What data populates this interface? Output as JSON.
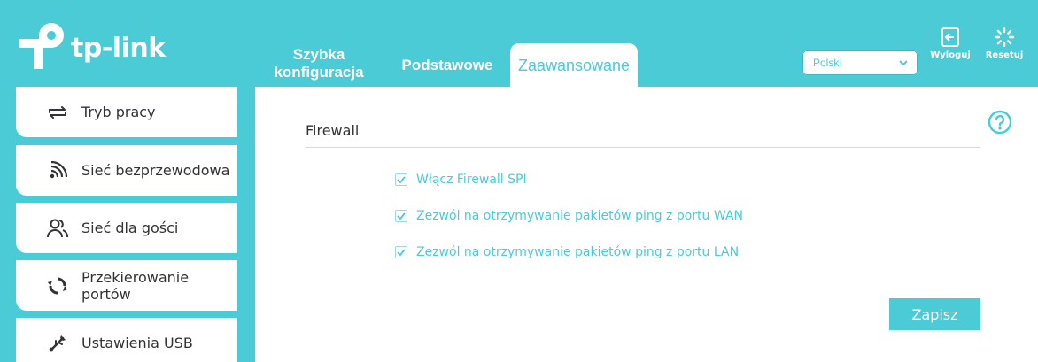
{
  "header": {
    "logo_text": "tp-link",
    "tabs": [
      {
        "line1": "Szybka",
        "line2": "konfiguracja"
      },
      {
        "label": "Podstawowe"
      },
      {
        "label": "Zaawansowane"
      }
    ],
    "language": "Polski",
    "logout_label": "Wyloguj",
    "reset_label": "Resetuj"
  },
  "sidebar": {
    "items": [
      {
        "label": "Tryb pracy",
        "icon": "mode-switch-icon"
      },
      {
        "label": "Sieć bezprzewodowa",
        "icon": "wifi-icon"
      },
      {
        "label": "Sieć dla gości",
        "icon": "guests-icon"
      },
      {
        "line1": "Przekierowanie",
        "line2": "portów",
        "icon": "port-forward-icon"
      },
      {
        "label": "Ustawienia USB",
        "icon": "usb-icon"
      }
    ]
  },
  "main": {
    "title": "Firewall",
    "checkboxes": [
      {
        "label": "Włącz Firewall SPI",
        "checked": true
      },
      {
        "label": "Zezwól na otrzymywanie pakietów ping z portu WAN",
        "checked": true
      },
      {
        "label": "Zezwól na otrzymywanie pakietów ping z portu LAN",
        "checked": true
      }
    ],
    "save_label": "Zapisz"
  },
  "colors": {
    "accent": "#4acbd6",
    "text": "#333333",
    "divider": "#d8d8d8"
  }
}
